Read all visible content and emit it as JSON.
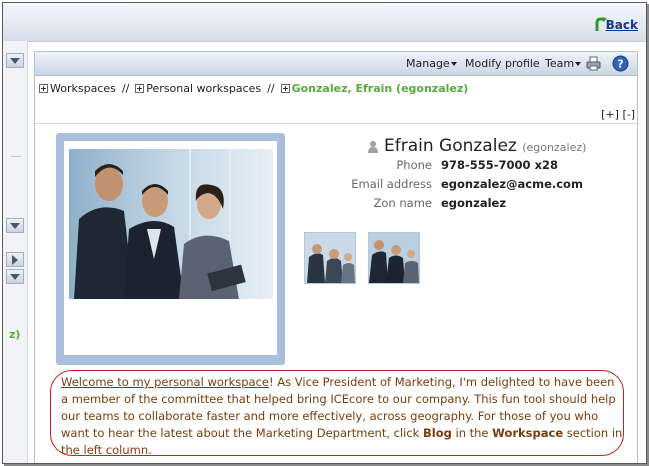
{
  "back": {
    "label": "Back"
  },
  "sidebar": {
    "partial_text": "z)"
  },
  "toolbar": {
    "manage": "Manage",
    "modify_profile": "Modify profile",
    "team": "Team"
  },
  "breadcrumb": {
    "items": [
      "Workspaces",
      "Personal workspaces",
      "Gonzalez, Efrain (egonzalez)"
    ],
    "separator": "//"
  },
  "expand": {
    "expand_label": "[+]",
    "collapse_label": "[-]"
  },
  "profile": {
    "name": "Efrain Gonzalez",
    "handle": "(egonzalez)",
    "fields": [
      {
        "label": "Phone",
        "value": "978-555-7000 x28"
      },
      {
        "label": "Email address",
        "value": "egonzalez@acme.com"
      },
      {
        "label": "Zon name",
        "value": "egonzalez"
      }
    ]
  },
  "description": {
    "link_text": "Welcome to my personal workspace",
    "text_1": "! As Vice President of Marketing, I'm delighted to have been a member of the committee that helped bring ICEcore to our company. This fun tool should help our teams to collaborate faster and more effectively, across geography. For those of you who want to hear the latest about the Marketing Department, click ",
    "bold_1": "Blog",
    "text_2": " in the ",
    "bold_2": "Workspace",
    "text_3": " section in the left column."
  },
  "colors": {
    "accent_green": "#5aab3a",
    "link_blue": "#0b3d8c",
    "highlight_red": "#c81e1e",
    "photo_frame": "#a9bfdb"
  },
  "icons": [
    "back-arrow-icon",
    "print-icon",
    "help-icon",
    "person-icon",
    "expand-box-icon",
    "chevron-down-icon",
    "chevron-right-icon"
  ]
}
